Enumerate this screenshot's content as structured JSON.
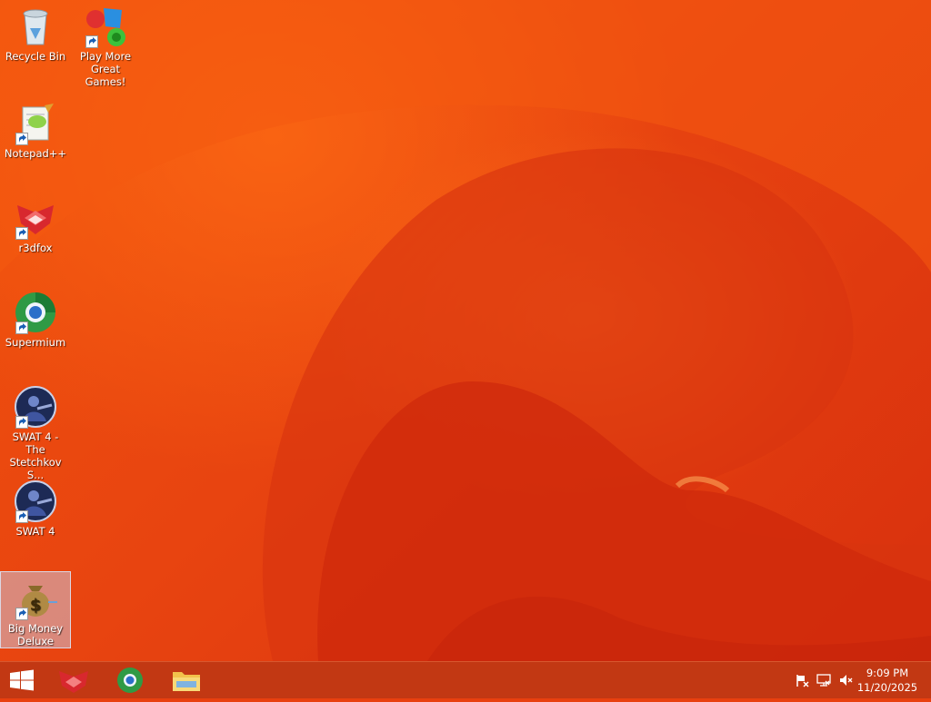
{
  "desktop": {
    "icons": [
      {
        "label": "Recycle Bin",
        "icon": "recycle-bin-icon",
        "shortcut": false
      },
      {
        "label": "Play More Great Games!",
        "icon": "games-icon",
        "shortcut": true
      },
      {
        "label": "Notepad++",
        "icon": "notepad-plus-plus-icon",
        "shortcut": true
      },
      {
        "label": "r3dfox",
        "icon": "r3dfox-icon",
        "shortcut": true
      },
      {
        "label": "Supermium",
        "icon": "supermium-icon",
        "shortcut": true
      },
      {
        "label": "SWAT 4 - The Stetchkov S...",
        "icon": "swat4-stetchkov-icon",
        "shortcut": true
      },
      {
        "label": "SWAT 4",
        "icon": "swat4-icon",
        "shortcut": true
      },
      {
        "label": "Big Money Deluxe",
        "icon": "big-money-deluxe-icon",
        "shortcut": true,
        "selected": true
      }
    ]
  },
  "taskbar": {
    "start": "windows-start-icon",
    "pinned": [
      "r3dfox-icon",
      "supermium-icon",
      "file-explorer-icon"
    ],
    "tray": [
      "action-center-flag-icon",
      "network-icon",
      "volume-muted-icon"
    ],
    "time": "9:09 PM",
    "date": "11/20/2025"
  },
  "colors": {
    "wallpaper": "#e8400f",
    "taskbar": "#be3714"
  }
}
